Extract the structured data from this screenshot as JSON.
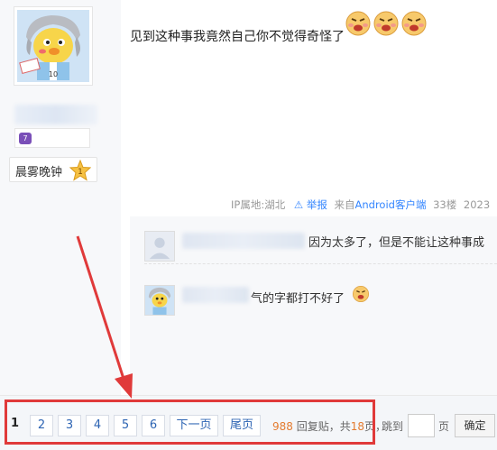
{
  "post": {
    "text": "见到这种事我竟然自己你不觉得奇怪了",
    "emoji_count": 3,
    "meta": {
      "ip": "IP属地:湖北",
      "report": "举报",
      "source_prefix": "来自",
      "source_client": "Android客户端",
      "floor": "33楼",
      "time": "2023"
    }
  },
  "author": {
    "badge_text": "晨雾晚钟"
  },
  "replies": [
    {
      "text": "因为太多了，但是不能让这种事成"
    },
    {
      "text": "气的字都打不好了"
    }
  ],
  "pager": {
    "current": "1",
    "pages": [
      "2",
      "3",
      "4",
      "5",
      "6"
    ],
    "next": "下一页",
    "last": "尾页",
    "reply_total": "988",
    "reply_label": "回复贴，共",
    "page_total": "18",
    "page_label": "页，",
    "jump_label": "跳到",
    "page_unit": "页",
    "confirm": "确定"
  },
  "colors": {
    "link": "#2d64b3",
    "highlight": "#e03a3a",
    "count": "#e47b2f"
  }
}
